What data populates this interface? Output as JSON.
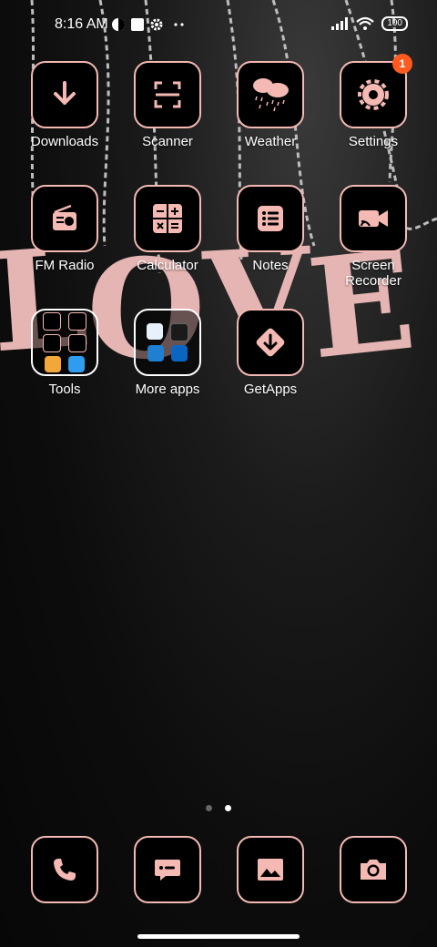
{
  "status_bar": {
    "time": "8:16 AM",
    "battery": "100"
  },
  "apps": [
    {
      "id": "downloads",
      "label": "Downloads",
      "icon": "download-icon"
    },
    {
      "id": "scanner",
      "label": "Scanner",
      "icon": "scan-icon"
    },
    {
      "id": "weather",
      "label": "Weather",
      "icon": "cloud-rain-icon"
    },
    {
      "id": "settings",
      "label": "Settings",
      "icon": "gear-icon",
      "badge": "1"
    },
    {
      "id": "fm-radio",
      "label": "FM Radio",
      "icon": "radio-icon"
    },
    {
      "id": "calculator",
      "label": "Calculator",
      "icon": "calculator-icon"
    },
    {
      "id": "notes",
      "label": "Notes",
      "icon": "list-icon"
    },
    {
      "id": "screen-recorder",
      "label": "Screen Recorder",
      "label_line1": "Screen",
      "label_line2": "Recorder",
      "icon": "video-icon"
    },
    {
      "id": "tools",
      "label": "Tools",
      "icon": "folder-icon"
    },
    {
      "id": "more-apps",
      "label": "More apps",
      "icon": "folder-icon"
    },
    {
      "id": "getapps",
      "label": "GetApps",
      "icon": "getapps-icon"
    }
  ],
  "dock": [
    {
      "id": "phone",
      "icon": "phone-icon"
    },
    {
      "id": "messages",
      "icon": "message-icon"
    },
    {
      "id": "gallery",
      "icon": "image-icon"
    },
    {
      "id": "camera",
      "icon": "camera-icon"
    }
  ],
  "pages": {
    "count": 2,
    "active": 2
  },
  "colors": {
    "accent": "#f4b9b3",
    "badge": "#ff5a1f",
    "wallpaper_text": "#e5b5b3"
  },
  "wallpaper_text": "LOVE"
}
